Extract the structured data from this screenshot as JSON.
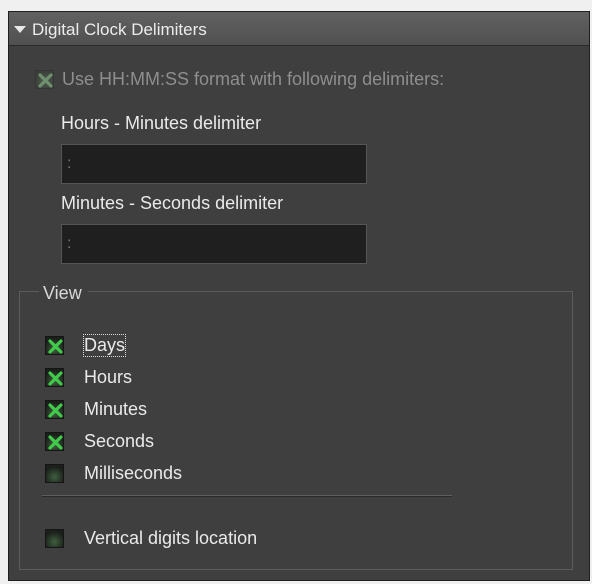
{
  "panel": {
    "title": "Digital Clock Delimiters",
    "collapse_icon": "triangle-down-icon"
  },
  "format_option": {
    "label": "Use HH:MM:SS format with following delimiters:",
    "checked": true,
    "enabled": false
  },
  "hours_minutes": {
    "label": "Hours - Minutes delimiter",
    "value": ":"
  },
  "minutes_seconds": {
    "label": "Minutes - Seconds delimiter",
    "value": ":"
  },
  "view": {
    "title": "View",
    "items": [
      {
        "label": "Days",
        "checked": true
      },
      {
        "label": "Hours",
        "checked": true
      },
      {
        "label": "Minutes",
        "checked": true
      },
      {
        "label": "Seconds",
        "checked": true
      },
      {
        "label": "Milliseconds",
        "checked": false
      }
    ],
    "vertical": {
      "label": "Vertical digits location",
      "checked": false
    }
  },
  "colors": {
    "panel_bg": "#3f3f3f",
    "check_mark": "#41c94a",
    "field_bg": "#1f1f1f"
  }
}
